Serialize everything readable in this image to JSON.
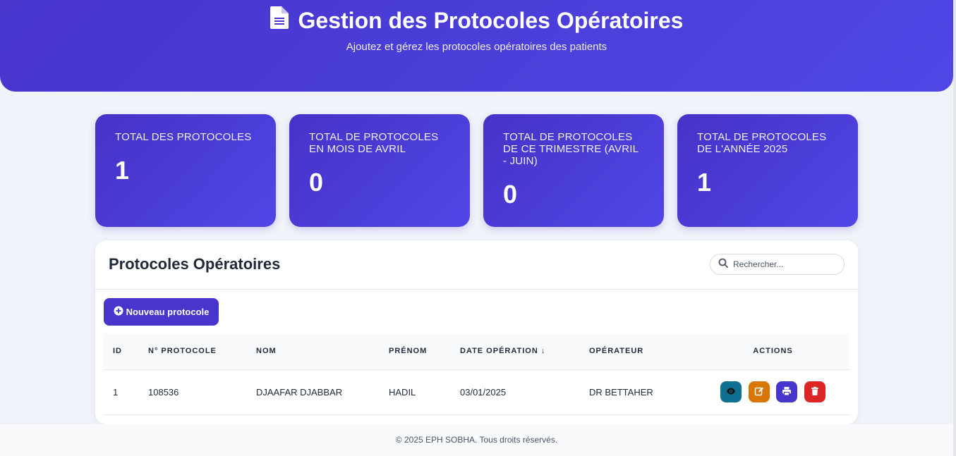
{
  "header": {
    "title": "Gestion des Protocoles Opératoires",
    "subtitle": "Ajoutez et gérez les protocoles opératoires des patients",
    "icon": "file-text-icon"
  },
  "stats": [
    {
      "label": "TOTAL DES PROTOCOLES",
      "value": "1"
    },
    {
      "label": "TOTAL DE PROTOCOLES EN MOIS DE AVRIL",
      "value": "0"
    },
    {
      "label": "TOTAL DE PROTOCOLES DE CE TRIMESTRE (AVRIL - JUIN)",
      "value": "0"
    },
    {
      "label": "TOTAL DE PROTOCOLES DE L'ANNÉE 2025",
      "value": "1"
    }
  ],
  "panel": {
    "title": "Protocoles Opératoires",
    "search_placeholder": "Rechercher...",
    "new_button_label": "Nouveau protocole"
  },
  "table": {
    "columns": [
      "ID",
      "N° PROTOCOLE",
      "NOM",
      "PRÉNOM",
      "DATE OPÉRATION ↓",
      "OPÉRATEUR",
      "ACTIONS"
    ],
    "rows": [
      {
        "id": "1",
        "protocole": "108536",
        "nom": "DJAAFAR DJABBAR",
        "prenom": "HADIL",
        "date": "03/01/2025",
        "operateur": "DR BETTAHER"
      }
    ]
  },
  "actions": [
    {
      "name": "view",
      "icon": "eye-icon",
      "color": "#0e7090"
    },
    {
      "name": "edit",
      "icon": "edit-icon",
      "color": "#d97706"
    },
    {
      "name": "print",
      "icon": "printer-icon",
      "color": "#4735cc"
    },
    {
      "name": "delete",
      "icon": "trash-icon",
      "color": "#dc2626"
    }
  ],
  "footer": {
    "text": "© 2025 EPH SOBHA. Tous droits réservés."
  },
  "colors": {
    "primary": "#4735cc",
    "background": "#f0f3f9"
  }
}
